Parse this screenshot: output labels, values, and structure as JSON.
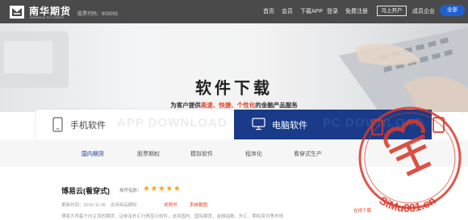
{
  "header": {
    "brand_cn": "南华期货",
    "brand_en": "NANHUA FUTURES",
    "stock_code": "股票代码：603093",
    "nav_items": [
      "首页",
      "会员",
      "下载APP",
      "登录",
      "免费注册"
    ],
    "open_account": "马上开户",
    "member_text": "成员企业",
    "all_button": "全部"
  },
  "hero": {
    "title": "软件下载",
    "subtitle_prefix": "为客户提供",
    "subtitle_highlight": "高速、快捷、个性化",
    "subtitle_suffix": "的金融产品服务"
  },
  "download_tabs": {
    "mobile_label": "手机软件",
    "mobile_ghost": "APP DOWNLOAD",
    "pc_label": "电脑软件",
    "pc_ghost": "PC DOWNLOAD"
  },
  "categories": [
    "国内期货",
    "股票期权",
    "模拟软件",
    "程序化",
    "看穿式生产"
  ],
  "product": {
    "title": "博易云(看穿式)",
    "rec_label": "推荐指数：",
    "rating": 5,
    "stars": "★★★★★",
    "meta": "更新时间：2019-11-05　支持商品期权",
    "link_manual": "说明书",
    "link_screens": "系统截图",
    "description": "博易大师基于内主流的期货、证券及外汇行情显示软件，支持国内、国际期货、金融指数、外汇、期权资讯等市场",
    "side_text": "在线下载"
  },
  "watermark": {
    "text": "SiMu001.cn",
    "seal_chars": "私募"
  },
  "colors": {
    "topbar": "#4a4a4a",
    "accent_blue": "#1a3a8a",
    "button_blue": "#1f5fcf",
    "highlight_red": "#e7442a",
    "star": "#f5a623",
    "stamp_red": "#d93a2a"
  },
  "icons": {
    "mobile": "smartphone-icon",
    "pc": "desktop-monitor-icon",
    "logo": "nanhua-logo-icon"
  }
}
